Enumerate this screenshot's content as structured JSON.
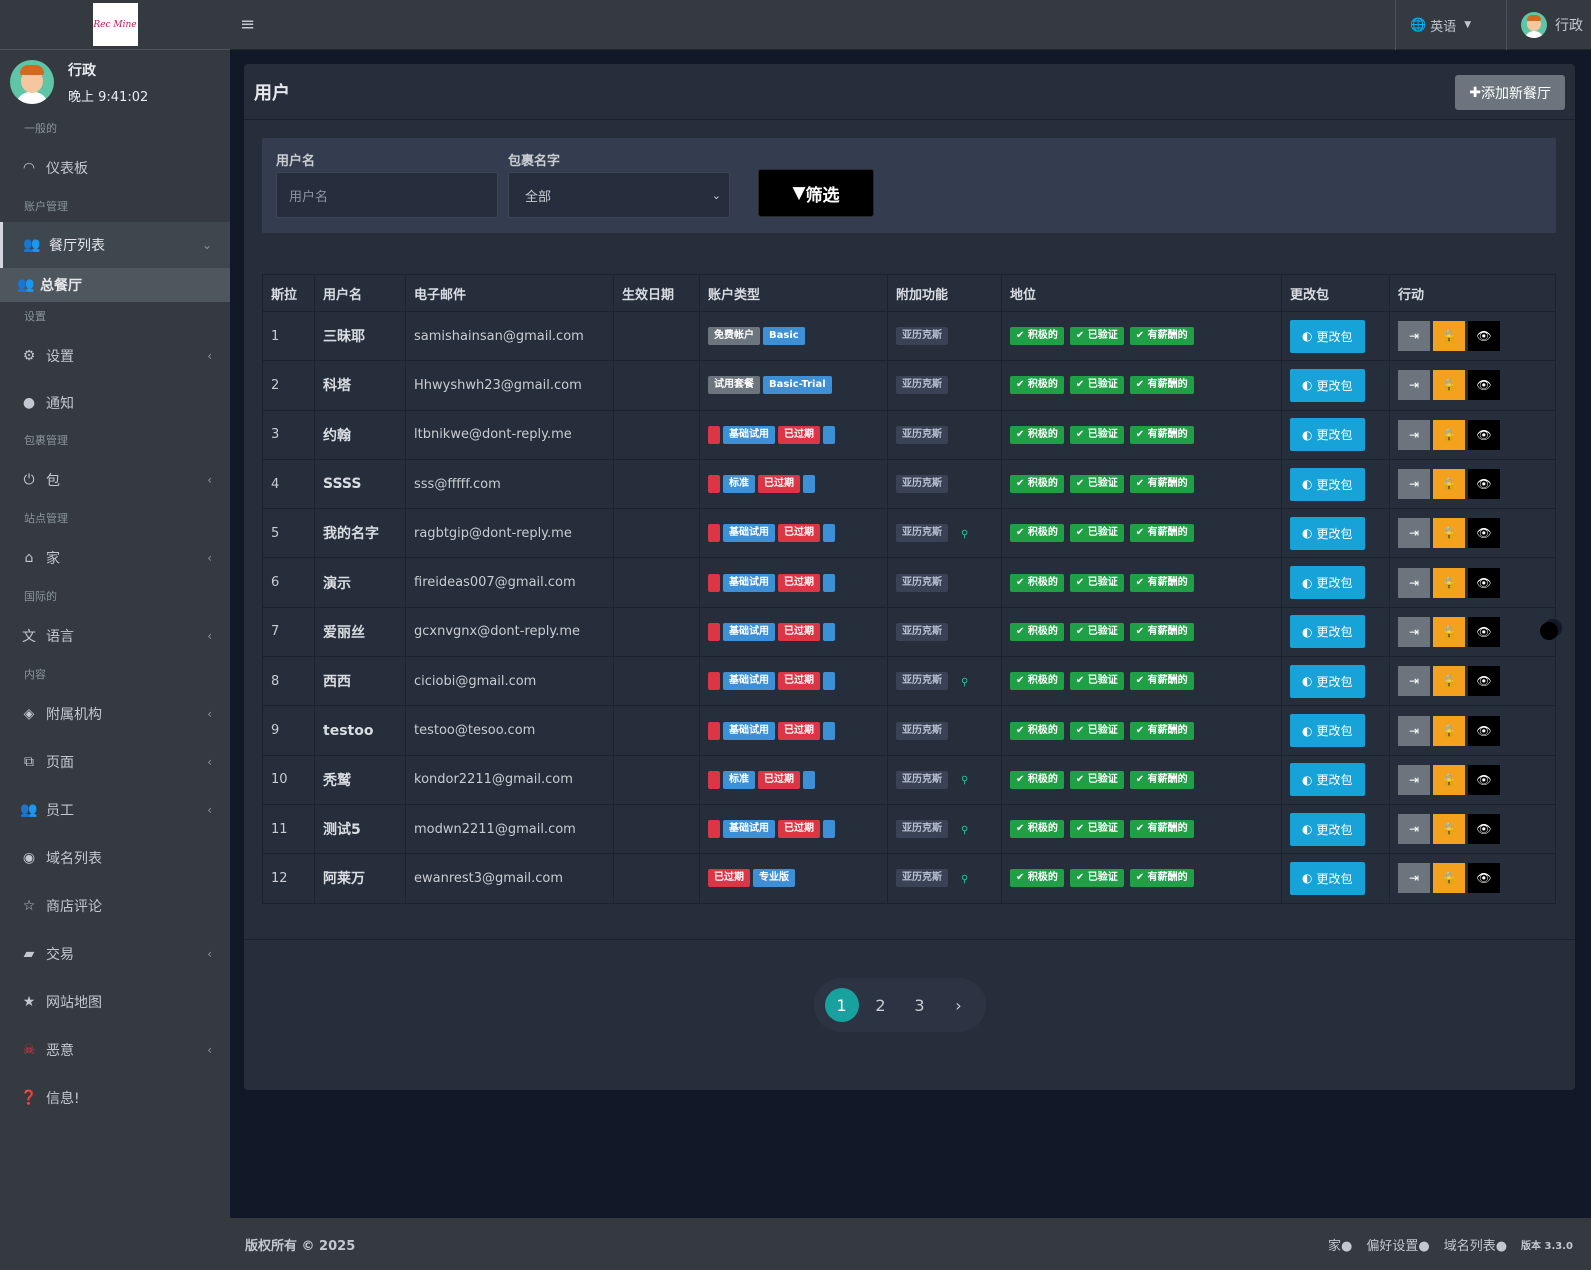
{
  "app": {
    "logo_text": "Rec Mine",
    "logo_color": "#c2185b"
  },
  "user": {
    "name": "行政",
    "time": "晚上 9:41:02"
  },
  "sidebar": {
    "sections": {
      "general": "一般的",
      "account": "账户管理",
      "settings": "设置",
      "package": "包裹管理",
      "site": "站点管理",
      "intl": "国际的",
      "content": "内容"
    },
    "items": {
      "dashboard": "仪表板",
      "restaurant_list": "餐厅列表",
      "all_restaurants": "总餐厅",
      "settings": "设置",
      "notify": "通知",
      "package": "包",
      "home": "家",
      "language": "语言",
      "affiliates": "附属机构",
      "pages": "页面",
      "staff": "员工",
      "domains": "域名列表",
      "reviews": "商店评论",
      "trade": "交易",
      "sitemap": "网站地图",
      "malicious": "恶意",
      "info": "信息!"
    }
  },
  "topbar": {
    "language": "英语",
    "user": "行政"
  },
  "page": {
    "title": "用户",
    "add_button": "添加新餐厅"
  },
  "filter": {
    "username_label": "用户名",
    "username_placeholder": "用户名",
    "package_label": "包裹名字",
    "package_value": "全部",
    "button": "筛选"
  },
  "table": {
    "headers": [
      "斯拉",
      "用户名",
      "电子邮件",
      "生效日期",
      "账户类型",
      "附加功能",
      "地位",
      "更改包",
      "行动"
    ],
    "addon": "亚历克斯",
    "status": [
      "积极的",
      "已验证",
      "有薪酬的"
    ],
    "change_pkg": "更改包",
    "rows": [
      {
        "sl": "1",
        "username": "三昧耶",
        "email": "samishainsan@gmail.com",
        "acct": [
          [
            "免费帐户",
            "gray"
          ],
          [
            "Basic",
            "blue"
          ]
        ],
        "loc": false
      },
      {
        "sl": "2",
        "username": "科塔",
        "email": "Hhwyshwh23@gmail.com",
        "acct": [
          [
            "试用套餐",
            "gray"
          ],
          [
            "Basic-Trial",
            "blue"
          ]
        ],
        "loc": false
      },
      {
        "sl": "3",
        "username": "约翰",
        "email": "ltbnikwe@dont-reply.me",
        "acct": [
          [
            "",
            "lred"
          ],
          [
            "基础试用",
            "blue"
          ],
          [
            "已过期",
            "red"
          ],
          [
            "",
            "lblue"
          ]
        ],
        "loc": false
      },
      {
        "sl": "4",
        "username": "SSSS",
        "email": "sss@fffff.com",
        "acct": [
          [
            "",
            "lred"
          ],
          [
            "标准",
            "blue"
          ],
          [
            "已过期",
            "red"
          ],
          [
            "",
            "lblue"
          ]
        ],
        "loc": false
      },
      {
        "sl": "5",
        "username": "我的名字",
        "email": "ragbtgip@dont-reply.me",
        "acct": [
          [
            "",
            "lred"
          ],
          [
            "基础试用",
            "blue"
          ],
          [
            "已过期",
            "red"
          ],
          [
            "",
            "lblue"
          ]
        ],
        "loc": true
      },
      {
        "sl": "6",
        "username": "演示",
        "email": "fireideas007@gmail.com",
        "acct": [
          [
            "",
            "lred"
          ],
          [
            "基础试用",
            "blue"
          ],
          [
            "已过期",
            "red"
          ],
          [
            "",
            "lblue"
          ]
        ],
        "loc": false
      },
      {
        "sl": "7",
        "username": "爱丽丝",
        "email": "gcxnvgnx@dont-reply.me",
        "acct": [
          [
            "",
            "lred"
          ],
          [
            "基础试用",
            "blue"
          ],
          [
            "已过期",
            "red"
          ],
          [
            "",
            "lblue"
          ]
        ],
        "loc": false
      },
      {
        "sl": "8",
        "username": "西西",
        "email": "ciciobi@gmail.com",
        "acct": [
          [
            "",
            "lred"
          ],
          [
            "基础试用",
            "blue"
          ],
          [
            "已过期",
            "red"
          ],
          [
            "",
            "lblue"
          ]
        ],
        "loc": true
      },
      {
        "sl": "9",
        "username": "testoo",
        "email": "testoo@tesoo.com",
        "acct": [
          [
            "",
            "lred"
          ],
          [
            "基础试用",
            "blue"
          ],
          [
            "已过期",
            "red"
          ],
          [
            "",
            "lblue"
          ]
        ],
        "loc": false
      },
      {
        "sl": "10",
        "username": "秃鹫",
        "email": "kondor2211@gmail.com",
        "acct": [
          [
            "",
            "lred"
          ],
          [
            "标准",
            "blue"
          ],
          [
            "已过期",
            "red"
          ],
          [
            "",
            "lblue"
          ]
        ],
        "loc": true
      },
      {
        "sl": "11",
        "username": "测试5",
        "email": "modwn2211@gmail.com",
        "acct": [
          [
            "",
            "lred"
          ],
          [
            "基础试用",
            "blue"
          ],
          [
            "已过期",
            "red"
          ],
          [
            "",
            "lblue"
          ]
        ],
        "loc": true
      },
      {
        "sl": "12",
        "username": "阿莱万",
        "email": "ewanrest3@gmail.com",
        "acct": [
          [
            "已过期",
            "red"
          ],
          [
            "专业版",
            "blue"
          ]
        ],
        "loc": true
      }
    ]
  },
  "pagination": {
    "pages": [
      "1",
      "2",
      "3"
    ],
    "next": "›",
    "active": "1"
  },
  "footer": {
    "copyright": "版权所有 © 2025",
    "links": [
      "家",
      "偏好设置",
      "域名列表"
    ],
    "version": "版本 3.3.0"
  }
}
